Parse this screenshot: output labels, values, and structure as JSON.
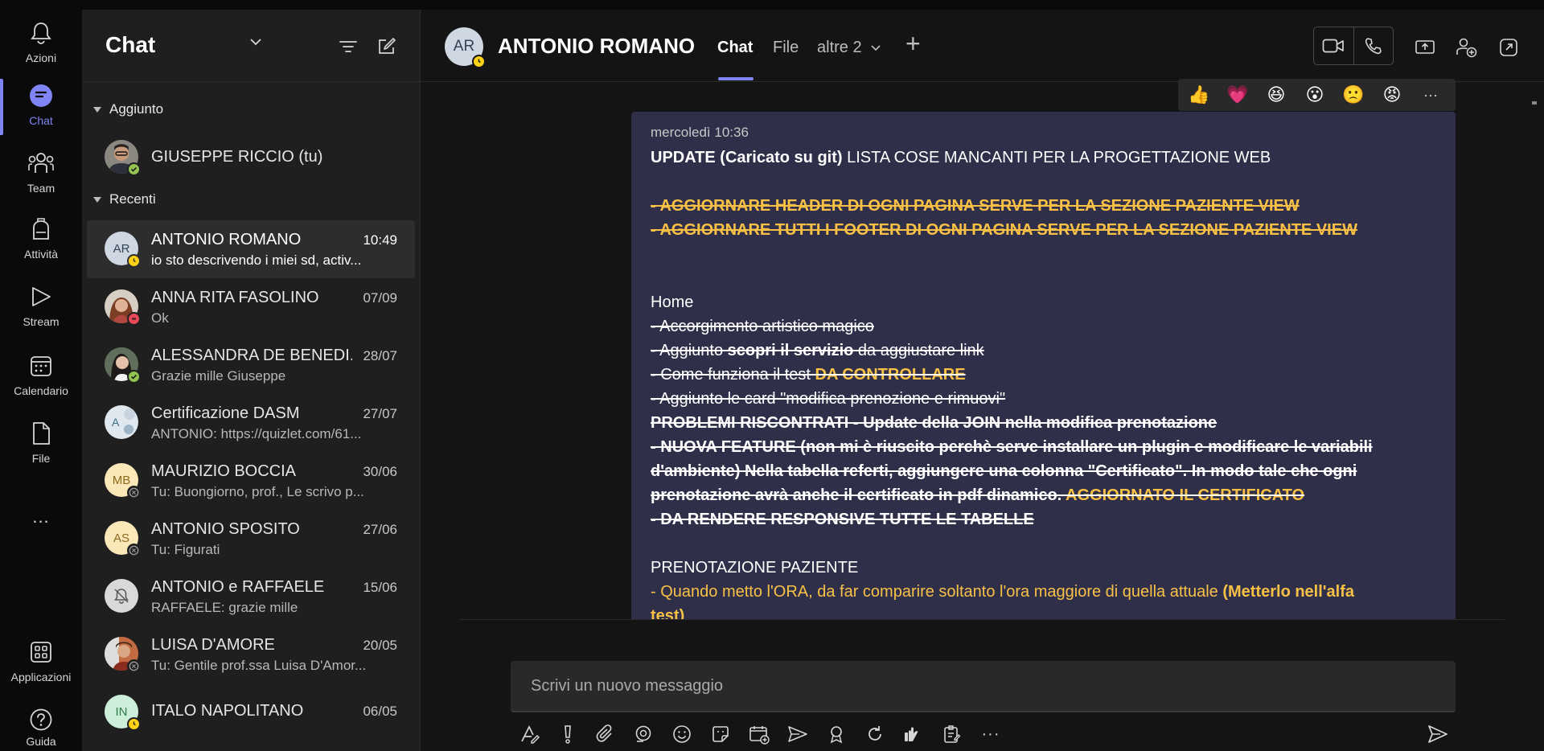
{
  "rail": {
    "items": [
      {
        "label": "Azioni",
        "icon": "bell-icon"
      },
      {
        "label": "Chat",
        "icon": "chat-icon"
      },
      {
        "label": "Team",
        "icon": "team-icon"
      },
      {
        "label": "Attività",
        "icon": "backpack-icon"
      },
      {
        "label": "Stream",
        "icon": "play-icon"
      },
      {
        "label": "Calendario",
        "icon": "calendar-icon"
      },
      {
        "label": "File",
        "icon": "file-icon"
      }
    ],
    "more": "...",
    "apps": "Applicazioni",
    "help": "Guida"
  },
  "chatlist": {
    "title": "Chat",
    "sections": {
      "pinned": "Aggiunto",
      "recent": "Recenti"
    },
    "pinned": {
      "name": "GIUSEPPE RICCIO (tu)"
    },
    "items": [
      {
        "initials": "AR",
        "name": "ANTONIO ROMANO",
        "time": "10:49",
        "preview": "io sto descrivendo i miei sd, activ...",
        "status": "away"
      },
      {
        "initials": "",
        "name": "ANNA RITA FASOLINO",
        "time": "07/09",
        "preview": "Ok",
        "status": "busy"
      },
      {
        "initials": "",
        "name": "ALESSANDRA DE BENEDI...",
        "time": "28/07",
        "preview": "Grazie mille Giuseppe",
        "status": "available"
      },
      {
        "initials": "A",
        "name": "Certificazione DASM",
        "time": "27/07",
        "preview": "ANTONIO: https://quizlet.com/61...",
        "status": ""
      },
      {
        "initials": "MB",
        "name": "MAURIZIO BOCCIA",
        "time": "30/06",
        "preview": "Tu: Buongiorno, prof., Le scrivo p...",
        "status": "offline"
      },
      {
        "initials": "AS",
        "name": "ANTONIO SPOSITO",
        "time": "27/06",
        "preview": "Tu: Figurati",
        "status": "offline"
      },
      {
        "initials": "",
        "name": "ANTONIO e RAFFAELE",
        "time": "15/06",
        "preview": "RAFFAELE: grazie mille",
        "status": ""
      },
      {
        "initials": "",
        "name": "LUISA D'AMORE",
        "time": "20/05",
        "preview": "Tu: Gentile prof.ssa Luisa D'Amor...",
        "status": "offline"
      },
      {
        "initials": "IN",
        "name": "ITALO NAPOLITANO",
        "time": "06/05",
        "preview": "",
        "status": "away"
      }
    ]
  },
  "header": {
    "initials": "AR",
    "name": "ANTONIO ROMANO",
    "tabs": [
      "Chat",
      "File",
      "altre 2"
    ],
    "add": "+"
  },
  "reactions": [
    "👍",
    "💗",
    "😆",
    "😮",
    "🙁",
    "😡",
    "···"
  ],
  "message": {
    "meta": "mercoledì 10:36",
    "update_bold": "UPDATE (Caricato su git)",
    "update_rest": " LISTA COSE MANCANTI PER LA PROGETTAZIONE WEB",
    "l1": "- AGGIORNARE HEADER DI OGNI PAGINA  SERVE PER LA SEZIONE PAZIENTE VIEW",
    "l2": "- AGGIORNARE TUTTI I FOOTER DI OGNI PAGINA SERVE PER LA SEZIONE PAZIENTE VIEW",
    "home": "Home",
    "h1": "- Accorgimento artistico magico",
    "h2a": "- Aggiunto ",
    "h2b": "scopri il servizio",
    "h2c": " da aggiustare link",
    "h3a": "- Come funziona il test ",
    "h3b": "DA CONTROLLARE",
    "h4": "- Aggiunto le card \"modifica prenozione e rimuovi\"",
    "h5": "PROBLEMI RISCONTRATI - Update della JOIN nella modifica prenotazione",
    "h6": "- NUOVA FEATURE (non mi è riuscito perchè serve installare un plugin e modificare le variabili",
    "h7": "d'ambiente) Nella tabella referti, aggiungere una colonna \"Certificato\". In modo tale che ogni",
    "h8a": "prenotazione avrà anche il certificato in pdf dinamico. ",
    "h8b": "AGGIORNATO IL CERTIFICATO",
    "h9": "- DA RENDERE RESPONSIVE TUTTE LE TABELLE",
    "pren": "PRENOTAZIONE PAZIENTE",
    "p1a": "- Quando metto l'ORA, da far comparire soltanto l'ora maggiore di quella attuale ",
    "p1b": "(Metterlo nell'alfa",
    "p2": "test)"
  },
  "compose": {
    "placeholder": "Scrivi un nuovo messaggio"
  },
  "colors": {
    "accent": "#7f85f5",
    "highlight": "#f8c146",
    "bubble": "#2f2f4a",
    "available": "#92c353",
    "busy": "#e74856",
    "away": "#fcd116"
  }
}
